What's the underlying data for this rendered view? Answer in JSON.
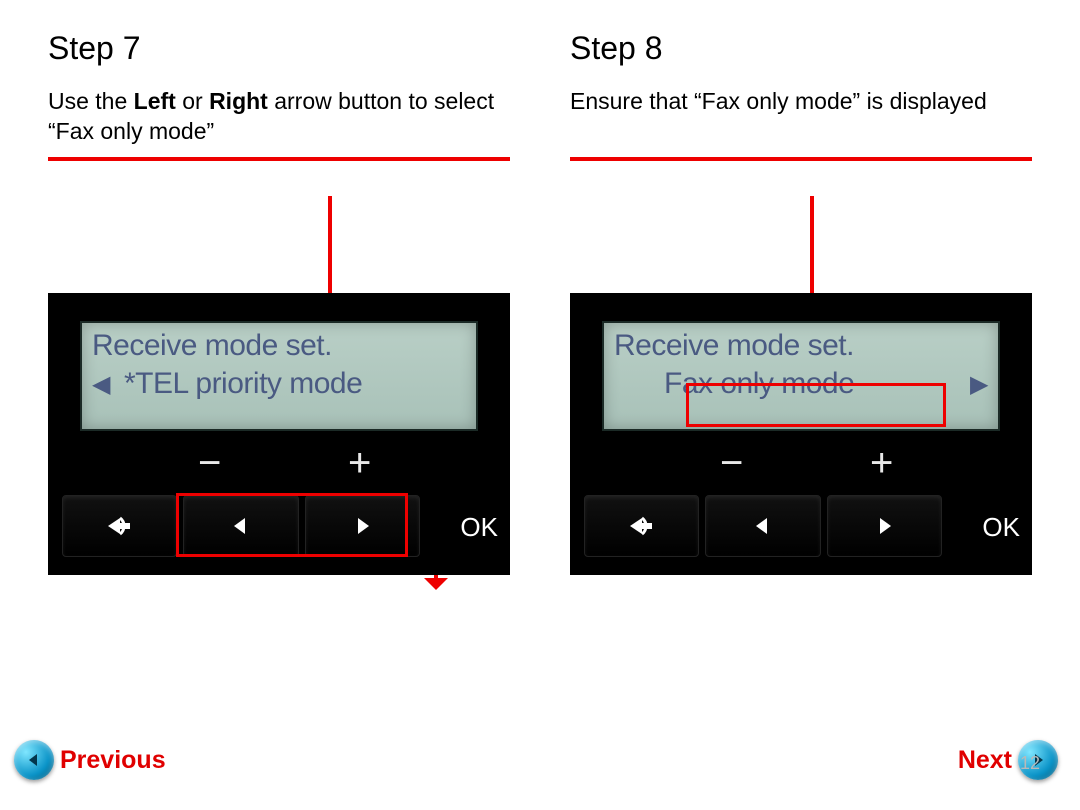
{
  "colors": {
    "accent": "#ee0000"
  },
  "page_number": "12",
  "nav": {
    "prev": "Previous",
    "next": "Next"
  },
  "step7": {
    "title": "Step 7",
    "desc_pre": "Use the ",
    "desc_b1": "Left",
    "desc_mid": " or ",
    "desc_b2": "Right",
    "desc_post": " arrow button to select “Fax only mode”",
    "lcd_line1": "Receive mode set.",
    "lcd_line2": "*TEL priority mode",
    "ok": "OK",
    "minus": "−",
    "plus": "+"
  },
  "step8": {
    "title": "Step 8",
    "desc": "Ensure that “Fax only mode” is displayed",
    "lcd_line1": "Receive mode set.",
    "lcd_line2": "Fax only mode",
    "ok": "OK",
    "minus": "−",
    "plus": "+"
  }
}
